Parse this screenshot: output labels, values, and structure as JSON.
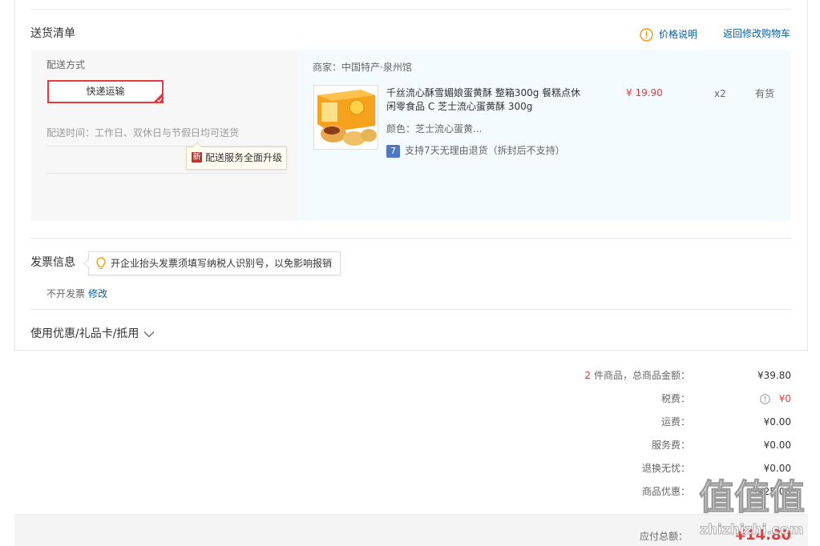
{
  "delivery_list": {
    "title": "送货清单",
    "price_note": "价格说明",
    "back_to_cart": "返回修改购物车",
    "shipping": {
      "method_label": "配送方式",
      "method": "快递运输",
      "time_text": "配送时间：工作日、双休日与节假日均可送货",
      "upgrade_badge": "新",
      "upgrade_text": "配送服务全面升级"
    },
    "shop": {
      "label": "商家：中国特产·泉州馆",
      "item": {
        "title": "千丝流心酥雪媚娘蛋黄酥 整箱300g 餐糕点休闲零食品 C 芝士流心蛋黄酥 300g",
        "color": "颜色：芝士流心蛋黄...",
        "return_badge": "7",
        "return_policy": "支持7天无理由退货（拆封后不支持）",
        "price": "¥ 19.90",
        "qty": "x2",
        "stock": "有货"
      }
    }
  },
  "invoice": {
    "title": "发票信息",
    "tip": "开企业抬头发票须填写纳税人识别号，以免影响报销",
    "status": "不开发票",
    "edit": "修改"
  },
  "coupons": {
    "label": "使用优惠/礼品卡/抵用"
  },
  "summary": {
    "count": "2",
    "count_label": "件商品，总商品金额：",
    "goods_amount": "¥39.80",
    "rows": [
      {
        "label": "税费：",
        "value": "¥0"
      },
      {
        "label": "运费：",
        "value": "¥0.00"
      },
      {
        "label": "服务费：",
        "value": "¥0.00"
      },
      {
        "label": "退换无忧：",
        "value": "¥0.00"
      },
      {
        "label": "商品优惠：",
        "value": "-¥25.00"
      }
    ]
  },
  "total": {
    "label": "应付总额：",
    "value": "¥14.80"
  },
  "watermark": {
    "logo": "值值值",
    "site": "zhizhizhi.com"
  },
  "icons": {
    "price_note": "warning-circle-icon",
    "selected": "selected-check-icon",
    "return": "seven-day-return-icon",
    "invoice_tip": "lightbulb-icon",
    "coupon_toggle": "chevron-down-icon",
    "tax_info": "info-circle-icon"
  },
  "colors": {
    "accent": "#e4393c",
    "link": "#005ea7",
    "warning": "#f39800",
    "shipping_bg": "#f7f7f7",
    "shop_bg": "#f3fbfe"
  }
}
